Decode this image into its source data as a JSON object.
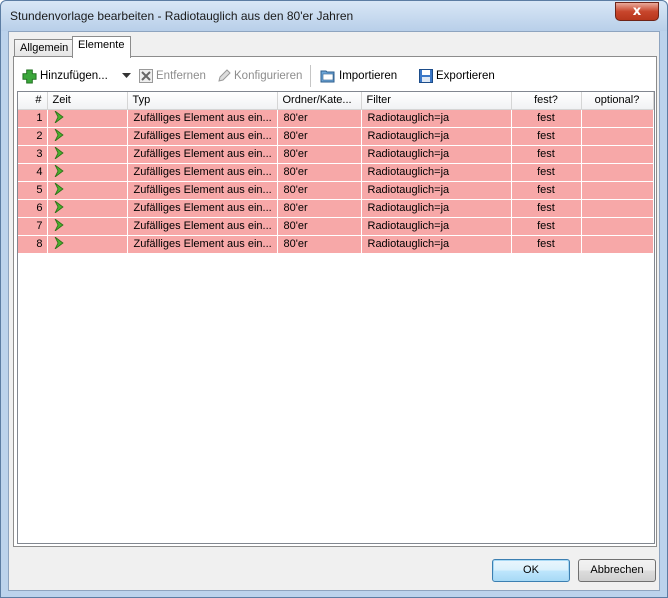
{
  "window": {
    "title": "Stundenvorlage bearbeiten - Radiotauglich aus den 80'er Jahren",
    "close_label": "x"
  },
  "tabs": [
    {
      "label": "Allgemein"
    },
    {
      "label": "Elemente"
    }
  ],
  "toolbar": {
    "add_label": "Hinzufügen...",
    "remove_label": "Entfernen",
    "configure_label": "Konfigurieren",
    "import_label": "Importieren",
    "export_label": "Exportieren"
  },
  "grid": {
    "columns": [
      "#",
      "Zeit",
      "Typ",
      "Ordner/Kate...",
      "Filter",
      "fest?",
      "optional?"
    ],
    "rows": [
      {
        "num": "1",
        "typ": "Zufälliges Element aus ein...",
        "ordner": "80'er",
        "filter": "Radiotauglich=ja",
        "fest": "fest",
        "optional": ""
      },
      {
        "num": "2",
        "typ": "Zufälliges Element aus ein...",
        "ordner": "80'er",
        "filter": "Radiotauglich=ja",
        "fest": "fest",
        "optional": ""
      },
      {
        "num": "3",
        "typ": "Zufälliges Element aus ein...",
        "ordner": "80'er",
        "filter": "Radiotauglich=ja",
        "fest": "fest",
        "optional": ""
      },
      {
        "num": "4",
        "typ": "Zufälliges Element aus ein...",
        "ordner": "80'er",
        "filter": "Radiotauglich=ja",
        "fest": "fest",
        "optional": ""
      },
      {
        "num": "5",
        "typ": "Zufälliges Element aus ein...",
        "ordner": "80'er",
        "filter": "Radiotauglich=ja",
        "fest": "fest",
        "optional": ""
      },
      {
        "num": "6",
        "typ": "Zufälliges Element aus ein...",
        "ordner": "80'er",
        "filter": "Radiotauglich=ja",
        "fest": "fest",
        "optional": ""
      },
      {
        "num": "7",
        "typ": "Zufälliges Element aus ein...",
        "ordner": "80'er",
        "filter": "Radiotauglich=ja",
        "fest": "fest",
        "optional": ""
      },
      {
        "num": "8",
        "typ": "Zufälliges Element aus ein...",
        "ordner": "80'er",
        "filter": "Radiotauglich=ja",
        "fest": "fest",
        "optional": ""
      }
    ],
    "row_color": "#f7a8a8"
  },
  "buttons": {
    "ok_label": "OK",
    "cancel_label": "Abbrechen"
  },
  "icons": {
    "add": "plus-icon",
    "remove": "delete-icon",
    "configure": "pencil-icon",
    "import": "folder-open-icon",
    "export": "save-disk-icon",
    "time": "play-arrow-icon",
    "dropdown": "dropdown-arrow-icon"
  }
}
